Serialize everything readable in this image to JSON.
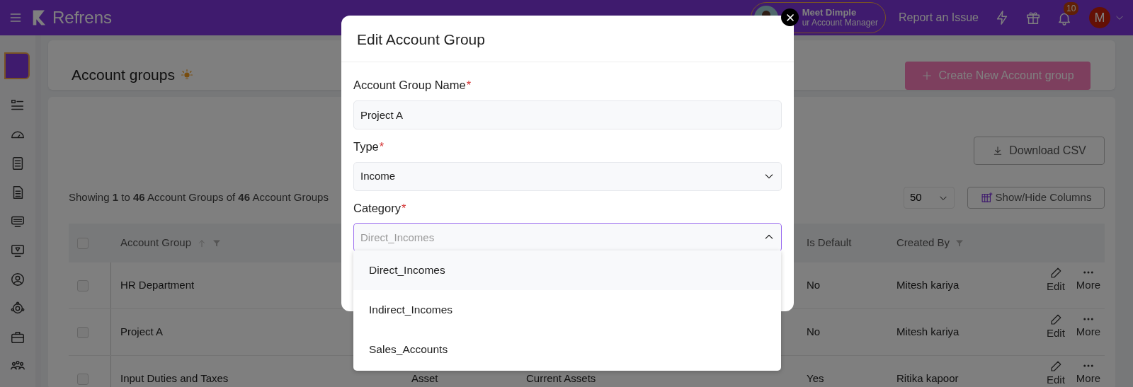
{
  "navbar": {
    "brand": "Refrens",
    "manager_name": "Meet Dimple",
    "manager_role": "ur Account Manager",
    "report": "Report an Issue",
    "notification_count": "10",
    "avatar_initial": "M"
  },
  "page": {
    "title": "Account groups",
    "create_button": "Create New Account group"
  },
  "toolbar": {
    "download_button": "Download CSV",
    "showing": "Showing **1** to **46** Account Groups of **46** Account Groups",
    "page_size": "50",
    "columns_button": "Show/Hide Columns"
  },
  "table": {
    "select_all_checked": false,
    "columns": [
      {
        "label": "Account Group",
        "sortable": true,
        "filterable": true
      },
      {
        "label": "Is Default",
        "sortable": false,
        "filterable": false
      },
      {
        "label": "Created By",
        "sortable": false,
        "filterable": true
      }
    ],
    "rows": [
      {
        "checked": false,
        "account_group": "HR Department",
        "is_default": "No",
        "created_by": "Mitesh kariya",
        "edit": "Edit",
        "more": "More"
      },
      {
        "checked": false,
        "account_group": "Project A",
        "is_default": "No",
        "created_by": "Mitesh kariya",
        "edit": "Edit",
        "more": "More"
      },
      {
        "checked": false,
        "account_group": "Input Duties and Taxes",
        "type": "Asset",
        "category": "Current Assets",
        "is_default": "Yes",
        "created_by": "Ritika kapoor",
        "edit": "Edit",
        "more": "More"
      }
    ]
  },
  "modal": {
    "title": "Edit Account Group",
    "fields": [
      {
        "kind": "text",
        "label": "Account Group Name",
        "required_mark": "*",
        "value": "Project A"
      },
      {
        "kind": "select",
        "label": "Type",
        "required_mark": "*",
        "value": "Income"
      },
      {
        "kind": "combobox",
        "label": "Category",
        "required_mark": "*",
        "placeholder": "Direct_Incomes",
        "expanded": true
      }
    ],
    "options": [
      {
        "label": "Direct_Incomes",
        "selected": true
      },
      {
        "label": "Indirect_Incomes",
        "selected": false
      },
      {
        "label": "Sales_Accounts",
        "selected": false
      }
    ]
  }
}
